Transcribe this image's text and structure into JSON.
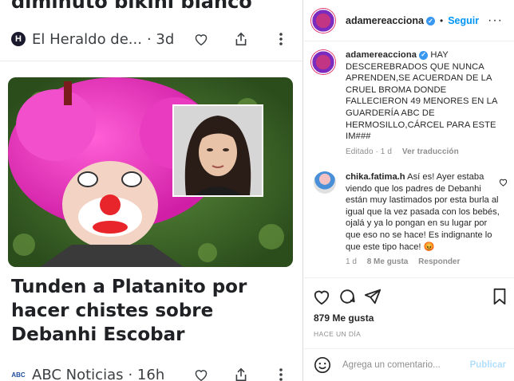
{
  "news": {
    "top_headline": "diminuto bikini blanco",
    "top_source": {
      "logo": "H",
      "name": "El Heraldo de...",
      "age": "· 3d"
    },
    "main_headline": "Tunden a Platanito por hacer chistes sobre Debanhi Escobar",
    "bottom_source": {
      "logo": "ABC",
      "name": "ABC Noticias",
      "age": "· 16h"
    },
    "icons": [
      "heart-icon",
      "share-icon",
      "more-vertical-icon"
    ]
  },
  "instagram": {
    "header": {
      "username": "adamereacciona",
      "separator": "•",
      "follow_label": "Seguir",
      "more": "···"
    },
    "caption": {
      "username": "adamereacciona",
      "text": "HAY DESCEREBRADOS QUE NUNCA APRENDEN,SE ACUERDAN DE LA CRUEL BROMA DONDE FALLECIERON 49 MENORES EN LA GUARDERÍA ABC DE HERMOSILLO,CÁRCEL PARA ESTE IM###",
      "edited": "Editado · 1 d",
      "translate": "Ver traducción"
    },
    "comment": {
      "username": "chika.fatima.h",
      "text": "Así es! Ayer estaba viendo que los padres de Debanhi están muy lastimados por esta burla al igual que la vez pasada con los bebés, ojalá y ya lo pongan en su lugar por que eso no se hace! Es indignante lo que este tipo hace! 😡",
      "age": "1 d",
      "likes": "8 Me gusta",
      "reply": "Responder"
    },
    "likes": "879 Me gusta",
    "time_ago": "HACE UN DÍA",
    "add_comment_placeholder": "Agrega un comentario...",
    "publish_label": "Publicar",
    "colors": {
      "link": "#0095f6",
      "publish_disabled": "#b2dffc",
      "muted": "#8e8e8e"
    }
  }
}
